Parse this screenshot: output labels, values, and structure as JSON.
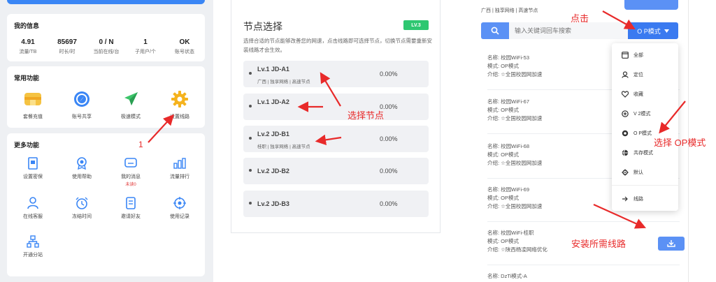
{
  "left": {
    "my_info": {
      "title": "我的信息",
      "stats": [
        {
          "value": "4.91",
          "label": "流量/TB"
        },
        {
          "value": "85697",
          "label": "时长/时"
        },
        {
          "value": "0 / N",
          "label": "当前在线/台"
        },
        {
          "value": "1",
          "label": "子用户/个"
        },
        {
          "value": "OK",
          "label": "账号状态"
        }
      ]
    },
    "common": {
      "title": "常用功能",
      "items": [
        {
          "label": "套餐充值",
          "icon": "package-icon"
        },
        {
          "label": "账号共享",
          "icon": "compass-icon"
        },
        {
          "label": "极速模式",
          "icon": "paper-plane-icon"
        },
        {
          "label": "设置线路",
          "icon": "gear-icon"
        }
      ]
    },
    "more": {
      "title": "更多功能",
      "items": [
        {
          "label": "设置密保",
          "icon": "document-icon"
        },
        {
          "label": "使用帮助",
          "icon": "medal-icon"
        },
        {
          "label": "我的消息",
          "icon": "message-icon",
          "sub": "未读0"
        },
        {
          "label": "流量排行",
          "icon": "bar-chart-icon"
        },
        {
          "label": "在线客服",
          "icon": "person-icon"
        },
        {
          "label": "冻结时间",
          "icon": "alarm-clock-icon"
        },
        {
          "label": "邀请好友",
          "icon": "invite-icon"
        },
        {
          "label": "使用记录",
          "icon": "target-icon"
        },
        {
          "label": "开通分站",
          "icon": "network-icon"
        }
      ]
    }
  },
  "middle": {
    "title": "节点选择",
    "level_badge": "LV.3",
    "description": "选择合适的节点能够改善您的网速，点击线路即可选择节点，切换节点需要重新安装线路才会生效。",
    "nodes": [
      {
        "name": "Lv.1 JD-A1",
        "tags": "广西 | 独享网络 | 高速节点",
        "percent": "0.00%"
      },
      {
        "name": "Lv.1 JD-A2",
        "tags": "",
        "percent": "0.00%"
      },
      {
        "name": "Lv.2 JD-B1",
        "tags": "桂职 | 独享网络 | 高速节点",
        "percent": "0.00%"
      },
      {
        "name": "Lv.2 JD-B2",
        "tags": "",
        "percent": "0.00%"
      },
      {
        "name": "Lv.2 JD-B3",
        "tags": "",
        "percent": "0.00%"
      }
    ]
  },
  "right": {
    "breadcrumb": "广西 | 独享网络 | 高速节点",
    "search_placeholder": "输入关键词回车搜索",
    "mode_button": "O P模式",
    "label_name": "名称: ",
    "label_mode": "模式: ",
    "label_intro": "介绍: ",
    "routes": [
      {
        "name": "校园WiFi-53",
        "mode": "OP模式",
        "intro": "☆全国校园网加速"
      },
      {
        "name": "校园WiFi-67",
        "mode": "OP模式",
        "intro": "☆全国校园网加速"
      },
      {
        "name": "校园WiFi-68",
        "mode": "OP模式",
        "intro": "☆全国校园网加速"
      },
      {
        "name": "校园WiFi-69",
        "mode": "OP模式",
        "intro": "☆全国校园网加速"
      },
      {
        "name": "校园WiFi-桂职",
        "mode": "OP模式",
        "intro": "☆陕西杨凌网络优化"
      },
      {
        "name": "DzTi模式-A",
        "mode": "",
        "intro": ""
      }
    ],
    "menu": [
      {
        "label": "全部",
        "icon": "window-icon"
      },
      {
        "label": "定位",
        "icon": "location-icon"
      },
      {
        "label": "收藏",
        "icon": "heart-icon"
      },
      {
        "label": "V 2模式",
        "icon": "plus-circle-icon"
      },
      {
        "label": "O P模式",
        "icon": "op-icon"
      },
      {
        "label": "共存模式",
        "icon": "globe-icon"
      },
      {
        "label": "默认",
        "icon": "gear-icon"
      },
      {
        "label": "线路",
        "icon": "arrow-right-icon"
      }
    ]
  },
  "annotations": {
    "number_1": "1",
    "select_node": "选择节点",
    "click": "点击",
    "select_op": "选择 OP模式",
    "install": "安装所需线路"
  }
}
